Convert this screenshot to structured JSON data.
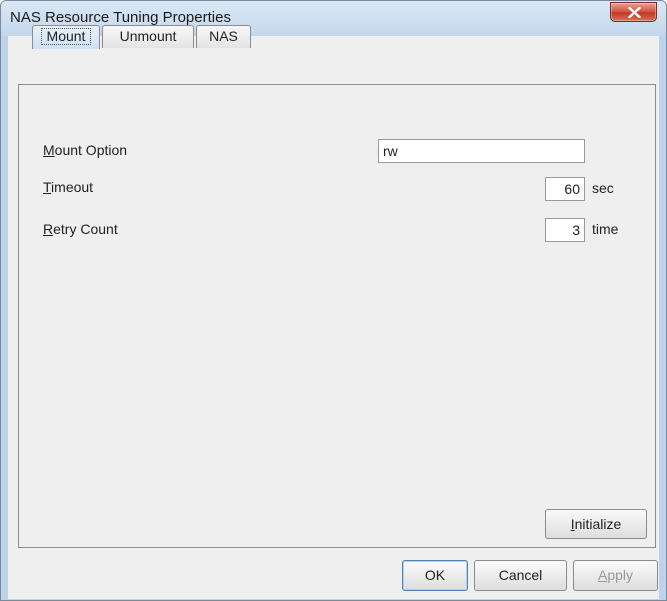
{
  "window": {
    "title": "NAS Resource Tuning Properties"
  },
  "tabs": [
    {
      "label": "Mount",
      "selected": true
    },
    {
      "label": "Unmount",
      "selected": false
    },
    {
      "label": "NAS",
      "selected": false
    }
  ],
  "form": {
    "mount_option": {
      "label_mnemonic": "M",
      "label_rest": "ount Option",
      "value": "rw"
    },
    "timeout": {
      "label_mnemonic": "T",
      "label_rest": "imeout",
      "value": "60",
      "unit": "sec"
    },
    "retry_count": {
      "label_mnemonic": "R",
      "label_rest": "etry Count",
      "value": "3",
      "unit": "time"
    }
  },
  "buttons": {
    "initialize": {
      "mnemonic": "I",
      "rest": "nitialize"
    },
    "ok": "OK",
    "cancel": "Cancel",
    "apply": {
      "mnemonic": "A",
      "rest": "pply",
      "enabled": false
    }
  },
  "icons": {
    "close": "close-icon"
  },
  "colors": {
    "close_button": "#c9473a",
    "title_bar": "#c8dcf0",
    "panel_bg": "#efefef"
  }
}
